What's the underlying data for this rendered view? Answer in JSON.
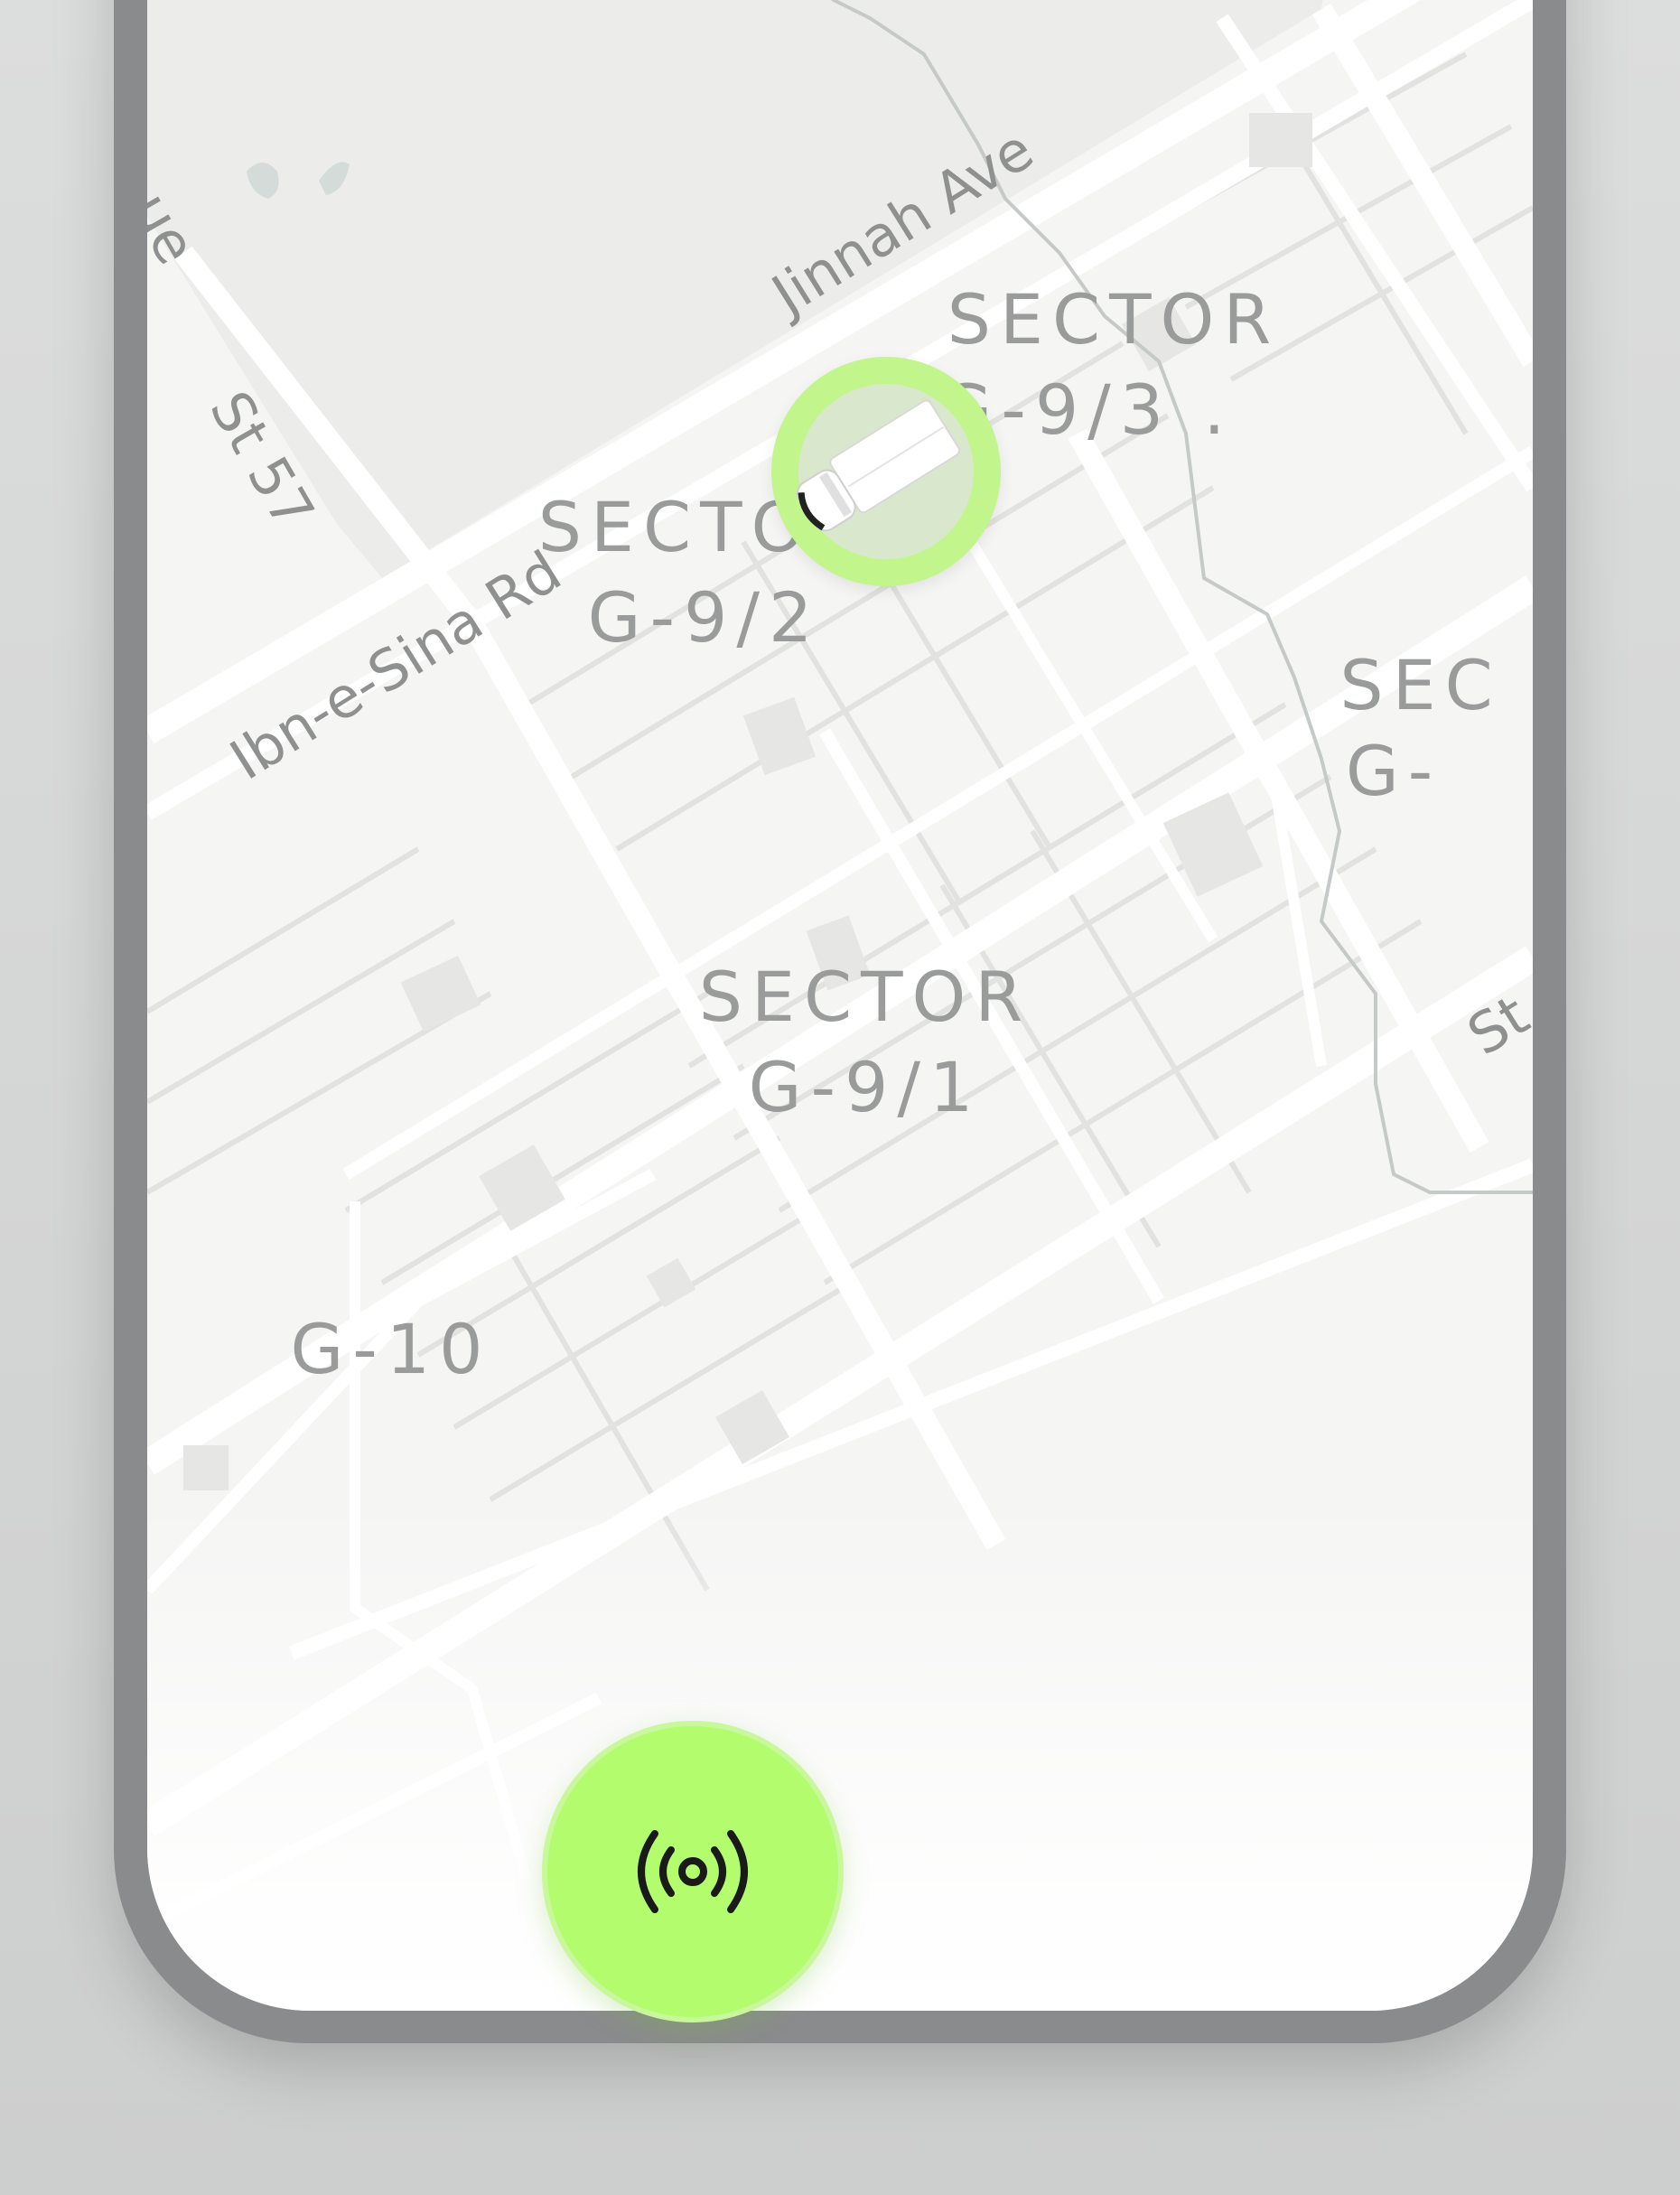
{
  "map": {
    "sectors": [
      {
        "line1": "SECTOR",
        "line2": "G-9/3 ."
      },
      {
        "line1": "SECTOR",
        "line2": "G-9/2"
      },
      {
        "line1": "SECTOR",
        "line2": "G-9/1"
      },
      {
        "line1": "SEC",
        "line2": "G-"
      }
    ],
    "area_labels": [
      "G-10"
    ],
    "roads": [
      "Jinnah Ave",
      "Ibn-e-Sina Rd",
      "St 57",
      "ue",
      "St"
    ]
  },
  "marker": {
    "icon": "truck-icon",
    "color": "#c2f58c"
  },
  "action_button": {
    "icon": "broadcast-icon",
    "color": "#b2fc6d"
  }
}
